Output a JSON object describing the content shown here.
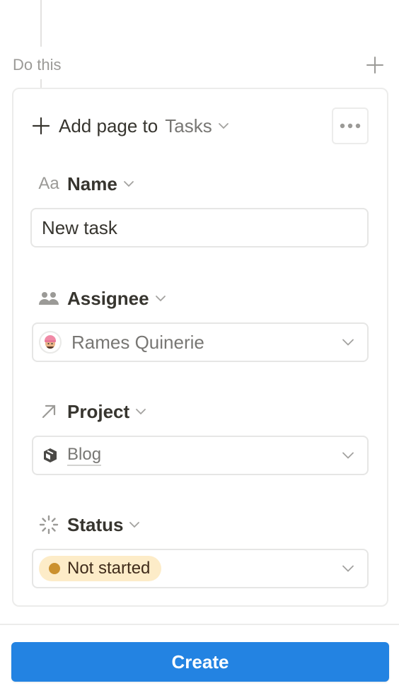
{
  "section": {
    "title": "Do this",
    "add_icon": "plus-icon"
  },
  "card": {
    "lead": "Add page to",
    "database": "Tasks",
    "more_icon": "ellipsis-icon",
    "properties": [
      {
        "icon": "text-aa-icon",
        "icon_text": "Aa",
        "label": "Name",
        "value": "New task"
      },
      {
        "icon": "people-icon",
        "label": "Assignee",
        "value": "Rames Quinerie"
      },
      {
        "icon": "arrow-up-right-icon",
        "label": "Project",
        "value": "Blog"
      },
      {
        "icon": "status-spinner-icon",
        "label": "Status",
        "value": "Not started"
      }
    ]
  },
  "status_colors": {
    "pill_bg": "#fdecc8",
    "dot": "#cb912f"
  },
  "footer": {
    "create_label": "Create",
    "accent": "#2383e2"
  }
}
